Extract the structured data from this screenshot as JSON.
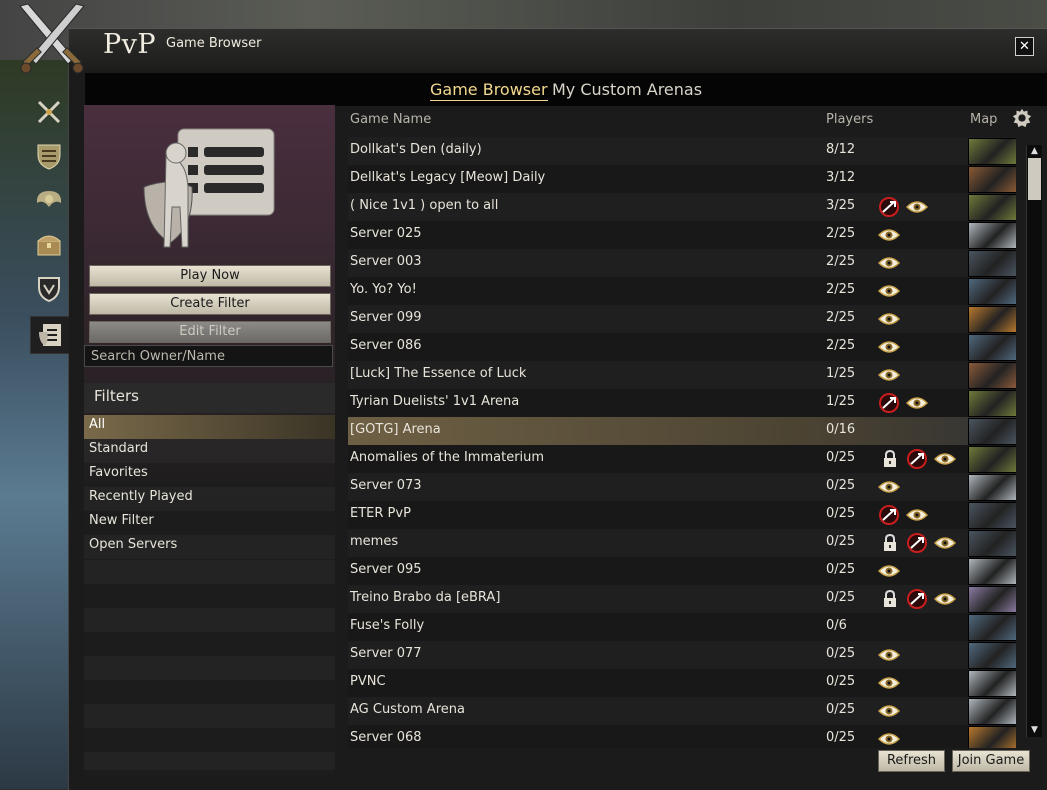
{
  "window": {
    "title": "PvP",
    "subtitle": "Game Browser",
    "close_label": "✕"
  },
  "tabs": [
    {
      "label": "Game Browser",
      "active": true
    },
    {
      "label": "My Custom Arenas",
      "active": false
    }
  ],
  "side_nav": [
    {
      "icon": "crossed-swords-icon"
    },
    {
      "icon": "shield-rank-icon"
    },
    {
      "icon": "winged-emblem-icon"
    },
    {
      "icon": "treasure-chest-icon"
    },
    {
      "icon": "guild-shield-icon"
    },
    {
      "icon": "list-browser-icon",
      "active": true
    }
  ],
  "left_panel": {
    "play_now": "Play Now",
    "create_filter": "Create Filter",
    "edit_filter": "Edit Filter",
    "search_placeholder": "Search Owner/Name",
    "filters_title": "Filters",
    "filters": [
      "All",
      "Standard",
      "Favorites",
      "Recently Played",
      "New Filter",
      "Open Servers"
    ],
    "selected_filter": "All"
  },
  "table": {
    "headers": {
      "name": "Game Name",
      "players": "Players",
      "map": "Map"
    },
    "rows": [
      {
        "name": "Dollkat's Den (daily)",
        "players": "8/12",
        "lock": false,
        "no_rank": false,
        "spectate": false,
        "map": "#6f7a3a"
      },
      {
        "name": "Dellkat's Legacy [Meow] Daily",
        "players": "3/12",
        "lock": false,
        "no_rank": false,
        "spectate": false,
        "map": "#8a5a34"
      },
      {
        "name": "( Nice 1v1 ) open to all",
        "players": "3/25",
        "lock": false,
        "no_rank": true,
        "spectate": true,
        "map": "#6f7a3a"
      },
      {
        "name": "Server 025",
        "players": "2/25",
        "lock": false,
        "no_rank": false,
        "spectate": true,
        "map": "#aeb6bd"
      },
      {
        "name": "Server 003",
        "players": "2/25",
        "lock": false,
        "no_rank": false,
        "spectate": true,
        "map": "#4a5560"
      },
      {
        "name": "Yo. Yo? Yo!",
        "players": "2/25",
        "lock": false,
        "no_rank": false,
        "spectate": true,
        "map": "#50697e"
      },
      {
        "name": "Server 099",
        "players": "2/25",
        "lock": false,
        "no_rank": false,
        "spectate": true,
        "map": "#b8782e"
      },
      {
        "name": "Server 086",
        "players": "2/25",
        "lock": false,
        "no_rank": false,
        "spectate": true,
        "map": "#50697e"
      },
      {
        "name": "[Luck] The Essence of Luck",
        "players": "1/25",
        "lock": false,
        "no_rank": false,
        "spectate": true,
        "map": "#8a5a3a"
      },
      {
        "name": "Tyrian Duelists' 1v1 Arena",
        "players": "1/25",
        "lock": false,
        "no_rank": true,
        "spectate": true,
        "map": "#6f7a3a"
      },
      {
        "name": "[GOTG] Arena",
        "players": "0/16",
        "lock": false,
        "no_rank": false,
        "spectate": false,
        "map": "#4a5560",
        "selected": true
      },
      {
        "name": "Anomalies of the Immaterium",
        "players": "0/25",
        "lock": true,
        "no_rank": true,
        "spectate": true,
        "map": "#6f7a3a"
      },
      {
        "name": "Server 073",
        "players": "0/25",
        "lock": false,
        "no_rank": false,
        "spectate": true,
        "map": "#aeb6bd"
      },
      {
        "name": "ETER PvP",
        "players": "0/25",
        "lock": false,
        "no_rank": true,
        "spectate": true,
        "map": "#4a5560"
      },
      {
        "name": "memes",
        "players": "0/25",
        "lock": true,
        "no_rank": true,
        "spectate": true,
        "map": "#4a5560"
      },
      {
        "name": "Server 095",
        "players": "0/25",
        "lock": false,
        "no_rank": false,
        "spectate": true,
        "map": "#aeb6bd"
      },
      {
        "name": "Treino Brabo da [eBRA]",
        "players": "0/25",
        "lock": true,
        "no_rank": true,
        "spectate": true,
        "map": "#8a7aa0"
      },
      {
        "name": "Fuse's Folly",
        "players": "0/6",
        "lock": false,
        "no_rank": false,
        "spectate": false,
        "map": "#50697e"
      },
      {
        "name": "Server 077",
        "players": "0/25",
        "lock": false,
        "no_rank": false,
        "spectate": true,
        "map": "#50697e"
      },
      {
        "name": "PVNC",
        "players": "0/25",
        "lock": false,
        "no_rank": false,
        "spectate": true,
        "map": "#aeb6bd"
      },
      {
        "name": "AG Custom Arena",
        "players": "0/25",
        "lock": false,
        "no_rank": false,
        "spectate": true,
        "map": "#aeb6bd"
      },
      {
        "name": "Server 068",
        "players": "0/25",
        "lock": false,
        "no_rank": false,
        "spectate": true,
        "map": "#b8782e"
      }
    ]
  },
  "footer": {
    "refresh": "Refresh",
    "join_game": "Join Game"
  }
}
